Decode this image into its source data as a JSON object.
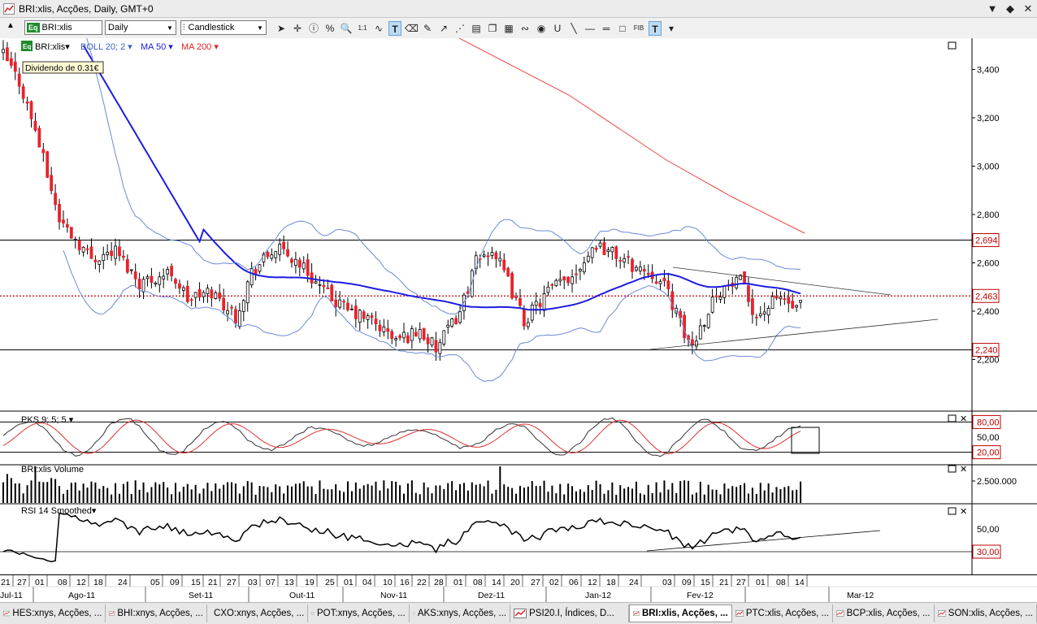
{
  "window": {
    "title": "BRI:xlis, Acções, Daily, GMT+0",
    "buttons": [
      "▼",
      "◆",
      "✕"
    ]
  },
  "toolbar": {
    "symbol_value": "BRI:xlis",
    "symbol_badge": "Eq",
    "period_value": "Daily",
    "charttype_value": "Candlestick",
    "tools": [
      {
        "name": "cursor-tool-icon",
        "glyph": "➤"
      },
      {
        "name": "crosshair-tool-icon",
        "glyph": "✛"
      },
      {
        "name": "info-tool-icon",
        "glyph": "ⓘ"
      },
      {
        "name": "percent-tool-icon",
        "glyph": "%"
      },
      {
        "name": "zoom-tool-icon",
        "glyph": "🔍"
      },
      {
        "name": "one-to-one-tool-icon",
        "glyph": "1:1"
      },
      {
        "name": "wave-tool-icon",
        "glyph": "∿"
      },
      {
        "name": "text-tool-icon",
        "glyph": "T"
      },
      {
        "name": "eraser-tool-icon",
        "glyph": "⌫"
      },
      {
        "name": "paint-tool-icon",
        "glyph": "✎"
      },
      {
        "name": "arrow-tool-icon",
        "glyph": "↗"
      },
      {
        "name": "pattern-tool-icon",
        "glyph": "⋰"
      },
      {
        "name": "layers-tool-icon",
        "glyph": "▤"
      },
      {
        "name": "copy-tool-icon",
        "glyph": "❐"
      },
      {
        "name": "calc-tool-icon",
        "glyph": "▦"
      },
      {
        "name": "signal-tool-icon",
        "glyph": "∾"
      },
      {
        "name": "radio-tool-icon",
        "glyph": "◉"
      },
      {
        "name": "magnet-tool-icon",
        "glyph": "U"
      },
      {
        "name": "line-tool-icon",
        "glyph": "╲"
      },
      {
        "name": "ray-tool-icon",
        "glyph": "—"
      },
      {
        "name": "hline-tool-icon",
        "glyph": "═"
      },
      {
        "name": "rect-tool-icon",
        "glyph": "□"
      },
      {
        "name": "fib-tool-icon",
        "glyph": "FIB"
      },
      {
        "name": "text2-tool-icon",
        "glyph": "T"
      },
      {
        "name": "more-tool-icon",
        "glyph": "▾"
      }
    ]
  },
  "chart_header": {
    "badge": "Eq",
    "symbol": "BRI:xlis",
    "boll": "BOLL 20; 2",
    "ma50": "MA 50",
    "ma200": "MA 200",
    "dividend": "Dividendo de 0.31€"
  },
  "colors": {
    "up": "#ffffff",
    "down": "#e8232d",
    "ma50": "#1c1ce0",
    "ma200": "#ee4444",
    "boll": "#6a8ad8",
    "hline": "#000000",
    "price_line": "#c00000"
  },
  "price_pane": {
    "ticks": [
      "3,400",
      "3,200",
      "3,000",
      "2,800",
      "2,600",
      "2,400",
      "2,200"
    ],
    "labels": {
      "resistance": "2,694",
      "current": "2,463",
      "support": "2,240"
    }
  },
  "pks_pane": {
    "label": "PKS 9; 5; 5",
    "ticks": [
      "80,00",
      "50,00",
      "20,00"
    ]
  },
  "volume_pane": {
    "label": "BRI:xlis Volume",
    "ticks": [
      "2.500.000"
    ]
  },
  "rsi_pane": {
    "label": "RSI 14 Smoothed",
    "ticks": [
      "50,00",
      "30,00"
    ]
  },
  "x_axis": {
    "days": [
      "21",
      "27",
      "01",
      "08",
      "12",
      "18",
      "24",
      "05",
      "09",
      "15",
      "21",
      "27",
      "03",
      "07",
      "13",
      "19",
      "25",
      "01",
      "04",
      "10",
      "16",
      "22",
      "28",
      "01",
      "08",
      "14",
      "20",
      "27",
      "02",
      "06",
      "12",
      "18",
      "24",
      "03",
      "09",
      "15",
      "21",
      "27",
      "01",
      "08",
      "14"
    ],
    "months": [
      "Jul-11",
      "Ago-11",
      "Set-11",
      "Out-11",
      "Nov-11",
      "Dez-11",
      "Jan-12",
      "Fev-12",
      "Mar-12"
    ]
  },
  "taskbar": {
    "items": [
      "HES:xnys, Acções, ...",
      "BHI:xnys, Acções, ...",
      "CXO:xnys, Acções, ...",
      "POT:xnys, Acções, ...",
      "AKS:xnys, Acções, ...",
      "PSI20.I, Índices, D...",
      "BRI:xlis, Acções, ...",
      "PTC:xlis, Acções, ...",
      "BCP:xlis, Acções, ...",
      "SON:xlis, Acções, ..."
    ],
    "active_index": 6
  }
}
